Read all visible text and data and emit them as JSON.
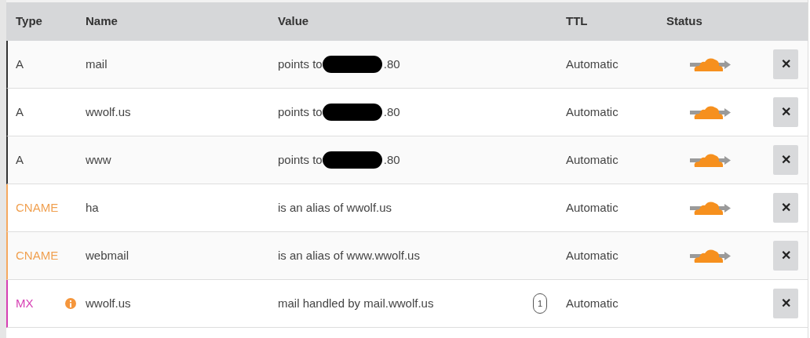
{
  "table": {
    "columns": [
      "Type",
      "Name",
      "Value",
      "TTL",
      "Status"
    ],
    "rows": [
      {
        "type": "A",
        "name": "mail",
        "value": "points to",
        "redacted": true,
        "value_end": ".80",
        "ttl": "Automatic",
        "proxied": true,
        "info": false
      },
      {
        "type": "A",
        "name": "wwolf.us",
        "value": "points to",
        "redacted": true,
        "value_end": ".80",
        "ttl": "Automatic",
        "proxied": true,
        "info": false
      },
      {
        "type": "A",
        "name": "www",
        "value": "points to",
        "redacted": true,
        "value_end": ".80",
        "ttl": "Automatic",
        "proxied": true,
        "info": false
      },
      {
        "type": "CNAME",
        "name": "ha",
        "value": "is an alias of wwolf.us",
        "redacted": false,
        "ttl": "Automatic",
        "proxied": true,
        "info": false
      },
      {
        "type": "CNAME",
        "name": "webmail",
        "value": "is an alias of www.wwolf.us",
        "redacted": false,
        "ttl": "Automatic",
        "proxied": true,
        "info": false
      },
      {
        "type": "MX",
        "name": "wwolf.us",
        "value": "mail handled by mail.wwolf.us",
        "redacted": false,
        "priority": "1",
        "ttl": "Automatic",
        "proxied": false,
        "info": true
      }
    ],
    "delete_button": "✕"
  }
}
